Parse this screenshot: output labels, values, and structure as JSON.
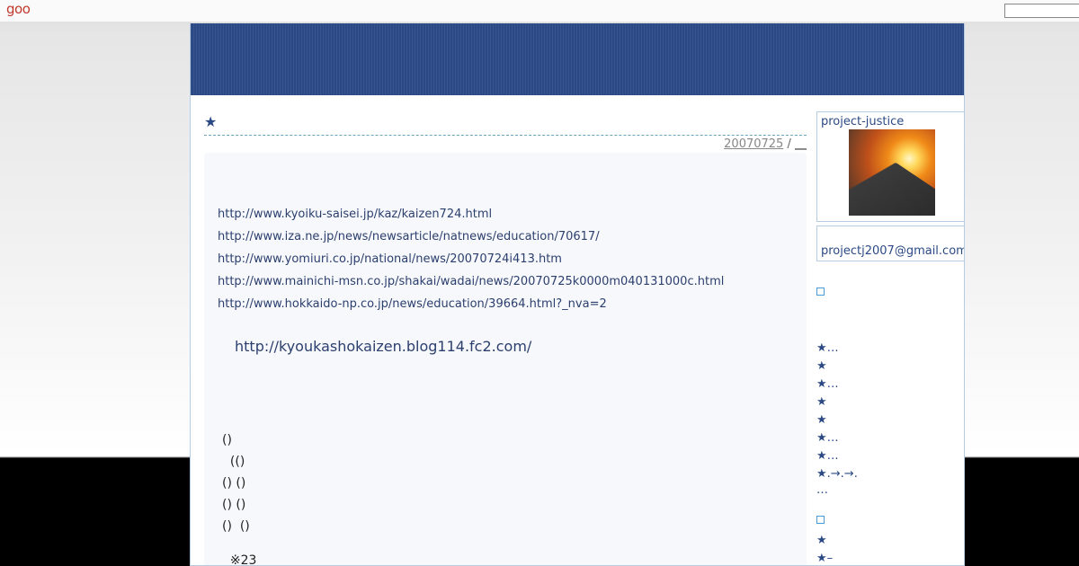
{
  "topbar": {
    "logo": "goo",
    "search_value": ""
  },
  "entry": {
    "title": "★",
    "date_link": "20070725",
    "separator": "/",
    "category_link": "__"
  },
  "links": [
    "http://www.kyoiku-saisei.jp/kaz/kaizen724.html",
    "http://www.iza.ne.jp/news/newsarticle/natnews/education/70617/",
    "http://www.yomiuri.co.jp/national/news/20070724i413.htm",
    "http://www.mainichi-msn.co.jp/shakai/wadai/news/20070725k0000m040131000c.html",
    "http://www.hokkaido-np.co.jp/news/education/39664.html?_nva=2"
  ],
  "big_link": "http://kyoukashokaizen.blog114.fc2.com/",
  "paragraphs": [
    "()",
    "  (()",
    "() ()",
    "() ()",
    "()  ()",
    "  ※23"
  ],
  "sidebar": {
    "profile_name": "project-justice",
    "email": "projectj2007@gmail.com",
    "list1": [
      "★…",
      "★",
      "★…",
      "★",
      "★",
      "★…",
      "★…",
      "★.→.→.",
      "…"
    ],
    "list2": [
      "★",
      "★–"
    ]
  },
  "colors": {
    "banner": "#2b4a85",
    "link": "#2b3f6e",
    "accent_border": "#b6cce2",
    "logo": "#c0392b"
  }
}
